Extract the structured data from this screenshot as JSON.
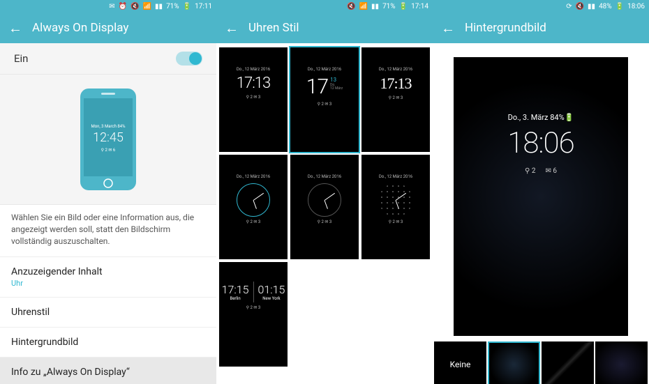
{
  "panel1": {
    "status": {
      "battery": "71%",
      "time": "17:11"
    },
    "header": "Always On Display",
    "toggle_label": "Ein",
    "preview_clock": "12:45",
    "description": "Wählen Sie ein Bild oder eine Information aus, die angezeigt werden soll, statt den Bildschirm vollständig auszuschalten.",
    "items": [
      {
        "title": "Anzuzeigender Inhalt",
        "sub": "Uhr"
      },
      {
        "title": "Uhrenstil"
      },
      {
        "title": "Hintergrundbild"
      },
      {
        "title": "Info zu „Always On Display“"
      }
    ]
  },
  "panel2": {
    "status": {
      "battery": "71%",
      "time": "17:14"
    },
    "header": "Uhren Stil",
    "thumbs": {
      "date_small": "Do., 12 März 2016",
      "t1": "17:13",
      "t2_big": "17",
      "t2_side": "13",
      "dual_a": "17:15",
      "dual_city_a": "Berlin",
      "dual_b": "01:15",
      "dual_city_b": "New York",
      "notif": "⚲ 2   ✉ 3"
    }
  },
  "panel3": {
    "status": {
      "battery": "48%",
      "time": "18:06"
    },
    "header": "Hintergrundbild",
    "preview": {
      "date": "Do., 3. März  84%🔋",
      "time": "18:06",
      "notif_calls": "⚲ 2",
      "notif_mail": "✉ 6"
    },
    "wall_none": "Keine"
  }
}
